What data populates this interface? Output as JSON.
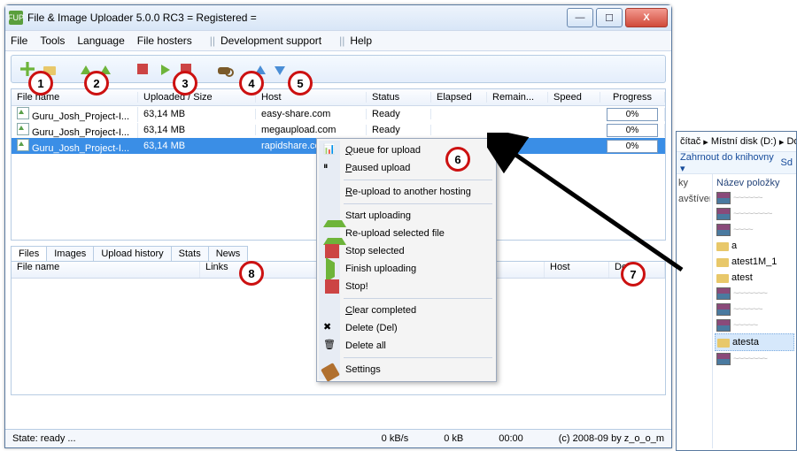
{
  "title": "File & Image Uploader 5.0.0 RC3  = Registered =",
  "menu": {
    "file": "File",
    "tools": "Tools",
    "lang": "Language",
    "hosters": "File hosters",
    "dev": "Development support",
    "help": "Help"
  },
  "columns": {
    "file": "File name",
    "size": "Uploaded / Size",
    "host": "Host",
    "status": "Status",
    "elapsed": "Elapsed",
    "remain": "Remain...",
    "speed": "Speed",
    "progress": "Progress"
  },
  "rows": [
    {
      "file": "Guru_Josh_Project-I...",
      "size": "63,14 MB",
      "host": "easy-share.com",
      "status": "Ready",
      "progress": "0%"
    },
    {
      "file": "Guru_Josh_Project-I...",
      "size": "63,14 MB",
      "host": "megaupload.com",
      "status": "Ready",
      "progress": "0%"
    },
    {
      "file": "Guru_Josh_Project-I...",
      "size": "63,14 MB",
      "host": "rapidshare.com",
      "status": "",
      "progress": "0%",
      "sel": true
    }
  ],
  "tabs": {
    "files": "Files",
    "images": "Images",
    "history": "Upload history",
    "stats": "Stats",
    "news": "News"
  },
  "cols2": {
    "file": "File name",
    "links": "Links",
    "host": "Host",
    "delete": "Delet..."
  },
  "status": {
    "state": "State: ready ...",
    "speed": "0 kB/s",
    "done": "0 kB",
    "time": "00:00",
    "copy": "(c) 2008-09 by z_o_o_m"
  },
  "ctx": {
    "queue": "Queue for upload",
    "paused": "Paused upload",
    "reup": "Re-upload to another hosting",
    "start": "Start uploading",
    "reupsel": "Re-upload selected file",
    "stopsel": "Stop selected",
    "finish": "Finish uploading",
    "stop": "Stop!",
    "clear": "Clear completed",
    "delete": "Delete (Del)",
    "delall": "Delete all",
    "settings": "Settings"
  },
  "explorer": {
    "crumb1": "čítač",
    "crumb2": "Místní disk (D:)",
    "crumb3": "Do",
    "toolbar": "Zahrnout do knihovny ▾",
    "toolbar2": "Sd",
    "nav": [
      "ky",
      "avštíver",
      " ",
      " "
    ],
    "header": "Název položky",
    "items": [
      {
        "t": "rar",
        "name": "~~~~~~",
        "blur": true
      },
      {
        "t": "rar",
        "name": "~~~~~~~~",
        "blur": true
      },
      {
        "t": "rar",
        "name": "~~~~",
        "blur": true
      },
      {
        "t": "fol",
        "name": "a"
      },
      {
        "t": "fol",
        "name": "atest1M_1"
      },
      {
        "t": "fol",
        "name": "atest"
      },
      {
        "t": "rar",
        "name": "~~~~~~~",
        "blur": true
      },
      {
        "t": "rar",
        "name": "~~~~~~",
        "blur": true
      },
      {
        "t": "rar",
        "name": "~~~~~",
        "blur": true
      },
      {
        "t": "fol",
        "name": "atesta",
        "sel": true
      },
      {
        "t": "rar",
        "name": "~~~~~~~",
        "blur": true
      }
    ]
  },
  "annotations": [
    "1",
    "2",
    "3",
    "4",
    "5",
    "6",
    "7",
    "8"
  ]
}
